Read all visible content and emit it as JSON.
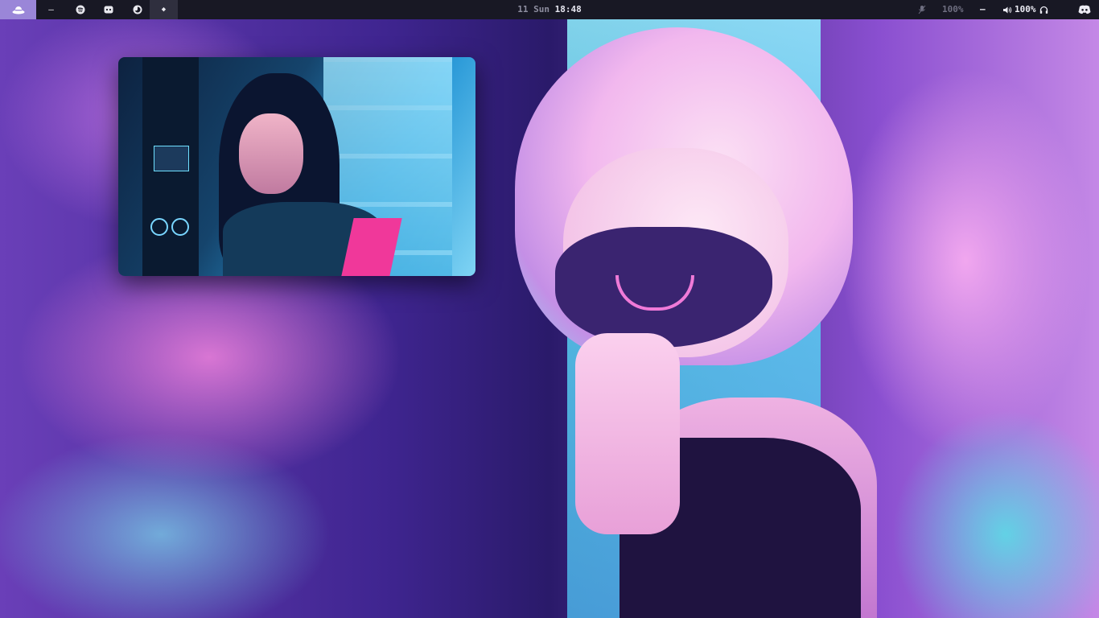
{
  "topbar": {
    "logo_icon": "fedora-hat-icon",
    "workspaces": [
      {
        "icon": "dash-icon",
        "glyph": "–"
      },
      {
        "icon": "spotify-icon",
        "glyph": "≋"
      },
      {
        "icon": "discord-icon",
        "glyph": "◙"
      },
      {
        "icon": "firefox-icon",
        "glyph": "◔"
      },
      {
        "icon": "diamond-icon",
        "glyph": "◆",
        "active": true
      }
    ],
    "clock": {
      "date": "11 Sun",
      "time": "18:48"
    },
    "right": {
      "mic_icon": "mic-muted-icon",
      "mic_level": "100%",
      "separator": "–",
      "volume_level": "100%",
      "headphones_icon": "headphones-icon",
      "discord_tray_icon": "discord-icon"
    }
  },
  "colors": {
    "bar_bg": "#181824",
    "logo_bg": "#9a86d8",
    "active_ws": "#2f2f3e"
  }
}
